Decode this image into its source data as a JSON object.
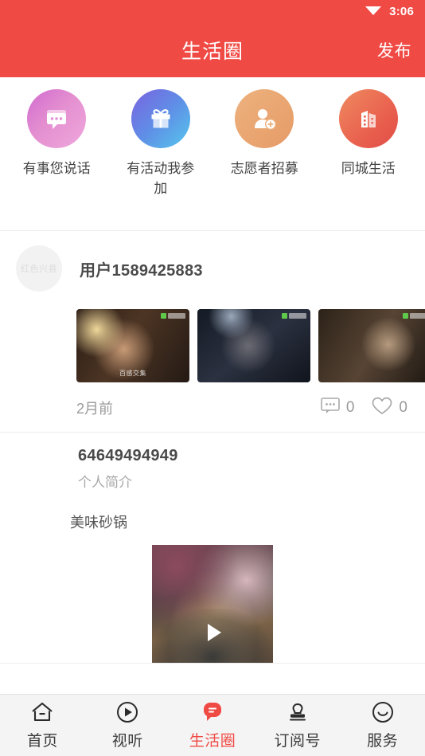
{
  "theme": {
    "accent": "#f04a45",
    "nav_bg": "#f4f4f4",
    "text": "#444444",
    "muted": "#9a9a9a"
  },
  "status_bar": {
    "time": "3:06",
    "wifi_icon": "wifi-icon"
  },
  "header": {
    "title": "生活圈",
    "action_label": "发布"
  },
  "quick_entries": [
    {
      "label": "有事您说话",
      "icon": "chat-bubble-icon"
    },
    {
      "label": "有活动我参加",
      "icon": "gift-icon"
    },
    {
      "label": "志愿者招募",
      "icon": "person-add-icon"
    },
    {
      "label": "同城生活",
      "icon": "building-icon"
    }
  ],
  "posts": [
    {
      "avatar_text": "红色兴县",
      "user_name": "用户1589425883",
      "time": "2月前",
      "comment_count": "0",
      "like_count": "0",
      "thumbs": [
        {
          "caption": "百感交集"
        },
        {
          "caption": ""
        },
        {
          "caption": ""
        }
      ]
    },
    {
      "user_name": "64649494949",
      "user_sub": "个人简介",
      "text": "美味砂锅",
      "video": {
        "play_icon": "play-icon"
      }
    }
  ],
  "tabbar": [
    {
      "label": "首页",
      "icon": "home-icon",
      "active": false
    },
    {
      "label": "视听",
      "icon": "play-circle-icon",
      "active": false
    },
    {
      "label": "生活圈",
      "icon": "chat-bubble-filled-icon",
      "active": true
    },
    {
      "label": "订阅号",
      "icon": "stamp-icon",
      "active": false
    },
    {
      "label": "服务",
      "icon": "smiley-icon",
      "active": false
    }
  ]
}
